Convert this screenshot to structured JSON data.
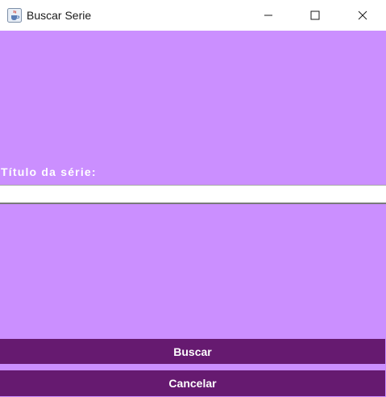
{
  "window": {
    "title": "Buscar Serie",
    "icon": "java-cup-icon",
    "controls": [
      "minimize-icon",
      "maximize-icon",
      "close-icon"
    ]
  },
  "form": {
    "title_label": "Título da série:",
    "title_input_value": "",
    "buttons": {
      "search_label": "Buscar",
      "cancel_label": "Cancelar"
    }
  },
  "colors": {
    "background": "#cb8fff",
    "button": "#661a70",
    "label_text": "#ffffff"
  }
}
